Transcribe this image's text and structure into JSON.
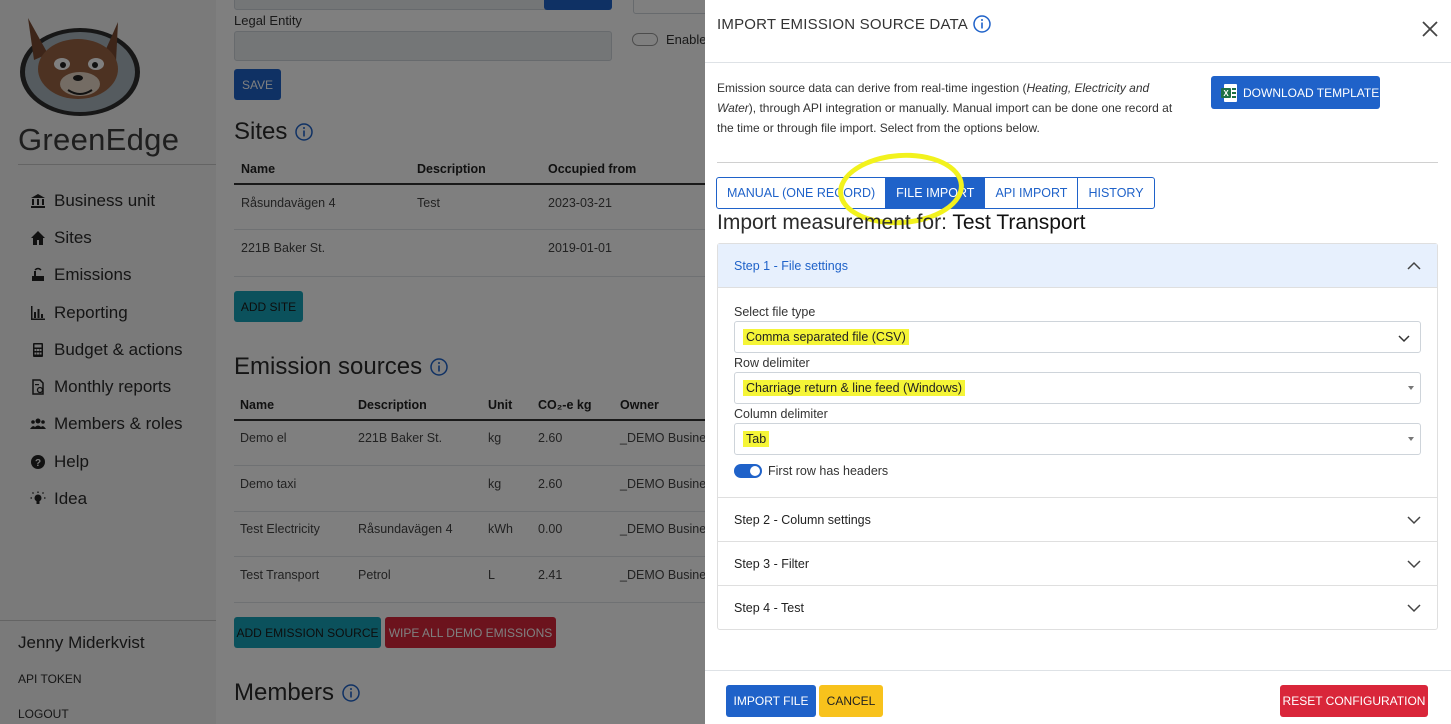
{
  "sidebar": {
    "brand": "GreenEdge",
    "nav": [
      {
        "label": "Business unit",
        "icon": "bank-icon"
      },
      {
        "label": "Sites",
        "icon": "home-icon"
      },
      {
        "label": "Emissions",
        "icon": "emissions-icon"
      },
      {
        "label": "Reporting",
        "icon": "bar-chart-icon"
      },
      {
        "label": "Budget & actions",
        "icon": "calculator-icon"
      },
      {
        "label": "Monthly reports",
        "icon": "report-icon"
      },
      {
        "label": "Members & roles",
        "icon": "users-icon"
      },
      {
        "label": "Help",
        "icon": "help-icon"
      },
      {
        "label": "Idea",
        "icon": "lightbulb-icon"
      }
    ],
    "user_name": "Jenny Miderkvist",
    "api_token": "API TOKEN",
    "logout": "LOGOUT"
  },
  "main": {
    "legal_entity_label": "Legal Entity",
    "enable_label": "Enable",
    "save_label": "SAVE",
    "sites": {
      "title": "Sites",
      "columns": [
        "Name",
        "Description",
        "Occupied from"
      ],
      "rows": [
        [
          "Råsundavägen 4",
          "Test",
          "2023-03-21"
        ],
        [
          "221B Baker St.",
          "",
          "2019-01-01"
        ]
      ],
      "add_label": "ADD SITE"
    },
    "emission_sources": {
      "title": "Emission sources",
      "columns": [
        "Name",
        "Description",
        "Unit",
        "CO₂-e kg",
        "Owner"
      ],
      "rows": [
        [
          "Demo el",
          "221B Baker St.",
          "kg",
          "2.60",
          "_DEMO Busines"
        ],
        [
          "Demo taxi",
          "",
          "kg",
          "2.60",
          "_DEMO Busines"
        ],
        [
          "Test Electricity",
          "Råsundavägen 4",
          "kWh",
          "0.00",
          "_DEMO Busines"
        ],
        [
          "Test Transport",
          "Petrol",
          "L",
          "2.41",
          "_DEMO Busines"
        ]
      ],
      "add_label": "ADD EMISSION SOURCE",
      "wipe_label": "WIPE ALL DEMO EMISSIONS"
    },
    "members_title": "Members"
  },
  "modal": {
    "title": "IMPORT EMISSION SOURCE DATA",
    "desc_1": "Emission source data can derive from real-time ingestion (",
    "desc_italic": "Heating, Electricity and Water",
    "desc_2": "), through API integration or manually. Manual import can be done one record at the time or through file import. Select from the options below.",
    "download_label": "DOWNLOAD TEMPLATE",
    "tabs": [
      "MANUAL (ONE RECORD)",
      "FILE IMPORT",
      "API IMPORT",
      "HISTORY"
    ],
    "active_tab": "FILE IMPORT",
    "import_heading_prefix": "Import measurement for: ",
    "import_heading_target": "Test Transport",
    "steps": [
      {
        "label": "Step 1 - File settings",
        "open": true
      },
      {
        "label": "Step 2 - Column settings",
        "open": false
      },
      {
        "label": "Step 3 - Filter",
        "open": false
      },
      {
        "label": "Step 4 - Test",
        "open": false
      }
    ],
    "file_type": {
      "label": "Select file type",
      "value": "Comma separated file (CSV)"
    },
    "row_delimiter": {
      "label": "Row delimiter",
      "value": "Charriage return & line feed (Windows)"
    },
    "column_delimiter": {
      "label": "Column delimiter",
      "value": "Tab"
    },
    "first_row_headers": {
      "label": "First row has headers",
      "checked": true
    },
    "import_label": "IMPORT FILE",
    "cancel_label": "CANCEL",
    "reset_label": "RESET CONFIGURATION"
  },
  "colors": {
    "primary": "#1f62c9",
    "warning": "#f8c21c",
    "danger": "#d9263a",
    "info": "#17a2b8",
    "highlight": "#f5f537"
  }
}
